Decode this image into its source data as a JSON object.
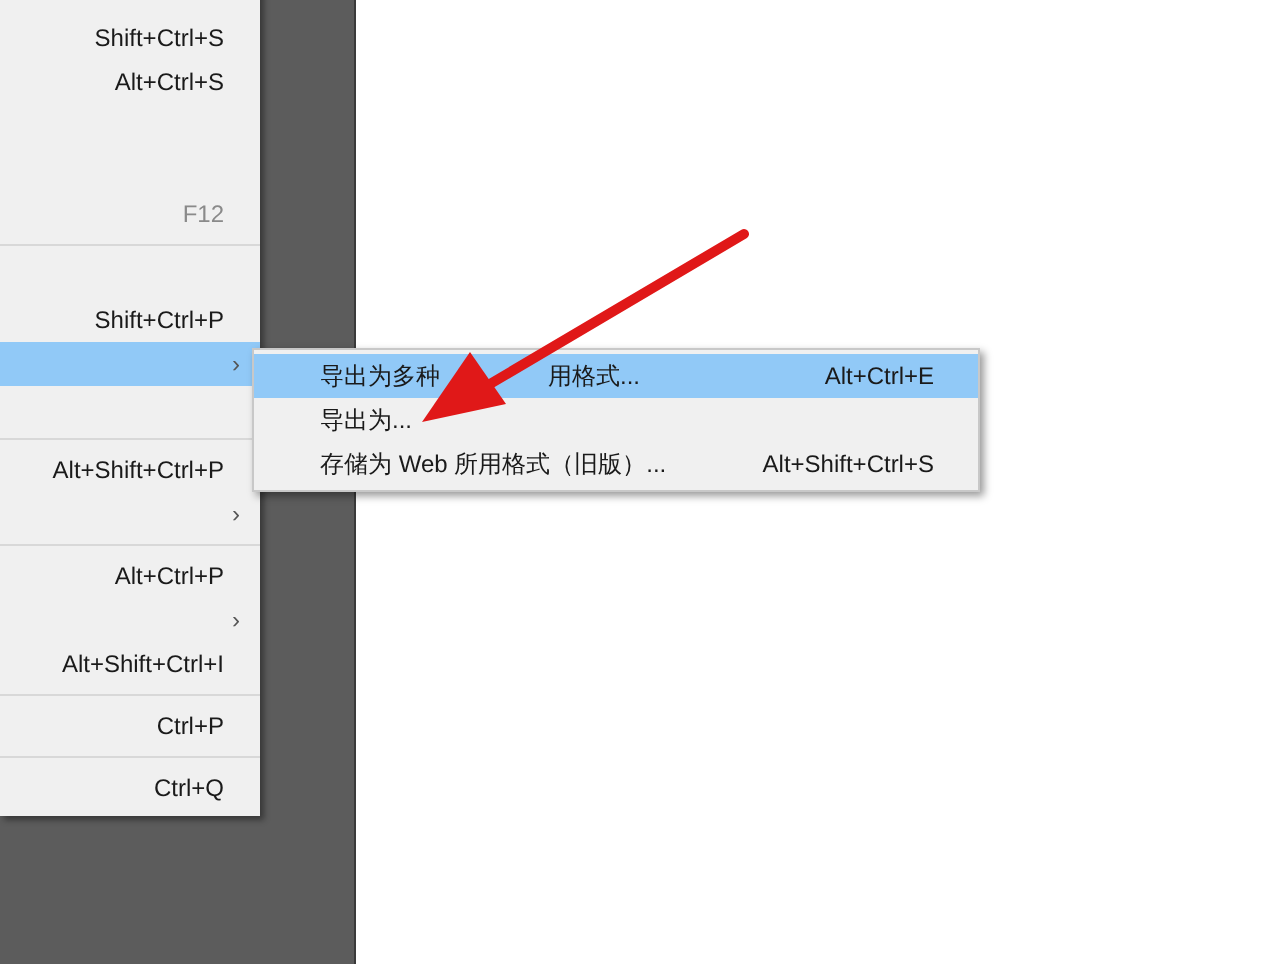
{
  "menu": {
    "items": [
      {
        "kind": "item"
      },
      {
        "kind": "item",
        "shortcut": "Shift+Ctrl+S"
      },
      {
        "kind": "item",
        "shortcut": "Alt+Ctrl+S"
      },
      {
        "kind": "item"
      },
      {
        "kind": "item"
      },
      {
        "kind": "item",
        "shortcut": "F12",
        "disabled": true
      },
      {
        "kind": "separator"
      },
      {
        "kind": "item"
      },
      {
        "kind": "item",
        "shortcut": "Shift+Ctrl+P"
      },
      {
        "kind": "item",
        "submenu": "›",
        "selected": true
      },
      {
        "kind": "item"
      },
      {
        "kind": "separator"
      },
      {
        "kind": "item",
        "shortcut": "Alt+Shift+Ctrl+P"
      },
      {
        "kind": "item",
        "submenu": "›"
      },
      {
        "kind": "separator"
      },
      {
        "kind": "item",
        "shortcut": "Alt+Ctrl+P"
      },
      {
        "kind": "item",
        "submenu": "›"
      },
      {
        "kind": "item",
        "shortcut": "Alt+Shift+Ctrl+I"
      },
      {
        "kind": "separator"
      },
      {
        "kind": "item",
        "shortcut": "Ctrl+P"
      },
      {
        "kind": "separator"
      },
      {
        "kind": "item",
        "shortcut": "Ctrl+Q"
      }
    ]
  },
  "submenu": {
    "items": [
      {
        "label_parts": [
          "导出为多种",
          "用格式..."
        ],
        "shortcut": "Alt+Ctrl+E",
        "selected": true
      },
      {
        "label": "导出为...",
        "selected": false
      },
      {
        "label": "存储为 Web 所用格式（旧版）...",
        "shortcut": "Alt+Shift+Ctrl+S",
        "selected": false
      }
    ]
  }
}
